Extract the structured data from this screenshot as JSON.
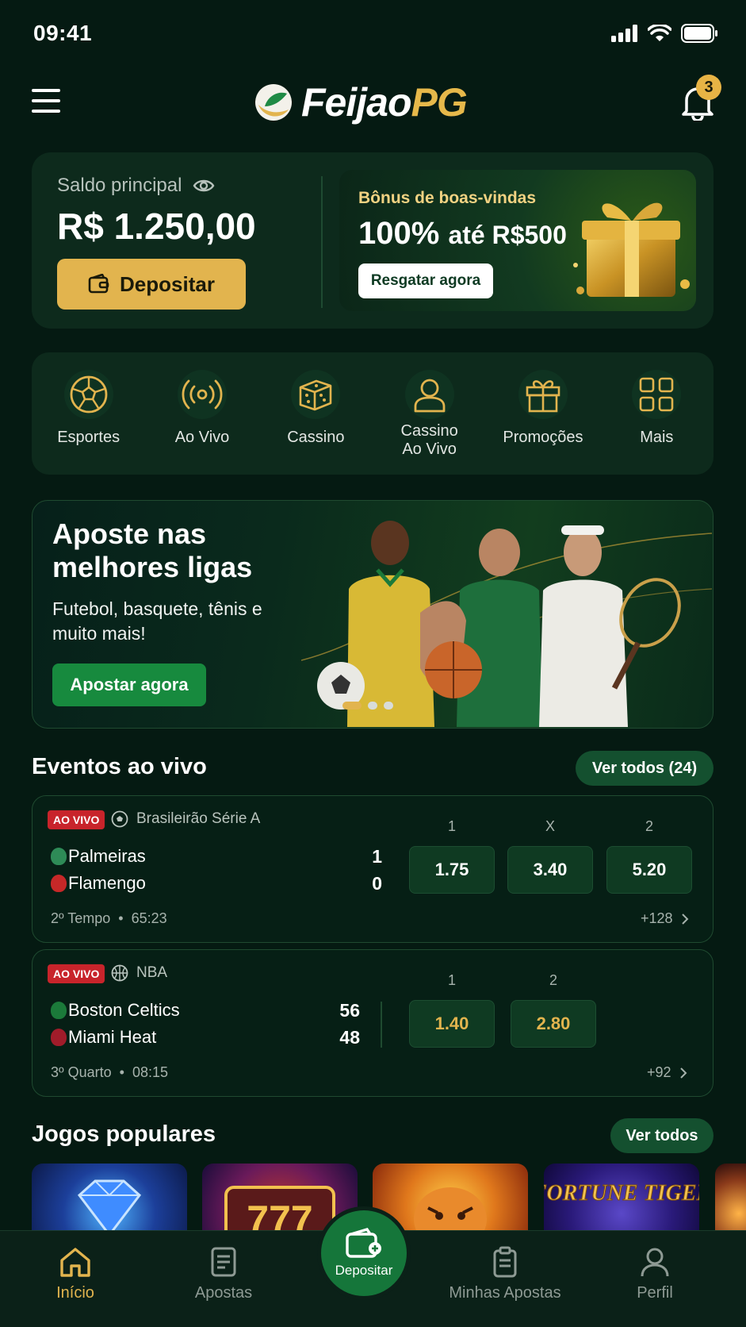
{
  "status_bar": {
    "time": "09:41"
  },
  "header": {
    "brand_main": "Feijao",
    "brand_accent": "PG",
    "notification_count": "3"
  },
  "balance": {
    "label": "Saldo principal",
    "value": "R$ 1.250,00",
    "deposit_label": "Depositar"
  },
  "bonus": {
    "subtitle": "Bônus de boas-vindas",
    "title_main": "100%",
    "title_rest": "até R$500",
    "button_label": "Resgatar agora"
  },
  "quick_nav": [
    {
      "label": "Esportes",
      "icon": "soccer-ball-icon"
    },
    {
      "label": "Ao Vivo",
      "icon": "live-broadcast-icon"
    },
    {
      "label": "Cassino",
      "icon": "dice-icon"
    },
    {
      "label": "Cassino Ao Vivo",
      "icon": "dealer-icon"
    },
    {
      "label": "Promoções",
      "icon": "gift-icon"
    },
    {
      "label": "Mais",
      "icon": "grid-icon"
    }
  ],
  "hero": {
    "title": "Aposte nas melhores ligas",
    "subtitle": "Futebol, basquete, tênis e muito mais!",
    "button_label": "Apostar agora",
    "slide_count": 3,
    "active_slide": 1
  },
  "live_section": {
    "title": "Eventos ao vivo",
    "view_all": "Ver todos (24)"
  },
  "events": [
    {
      "live_label": "AO VIVO",
      "league": "Brasileirão Série A",
      "teams": [
        {
          "name": "Palmeiras",
          "score": "1",
          "color": "#2e8b57"
        },
        {
          "name": "Flamengo",
          "score": "0",
          "color": "#c62828"
        }
      ],
      "odds_headers": [
        "1",
        "X",
        "2"
      ],
      "odds": [
        "1.75",
        "3.40",
        "5.20"
      ],
      "period": "2º Tempo",
      "clock": "65:23",
      "more_markets": "+128"
    },
    {
      "live_label": "AO VIVO",
      "league": "NBA",
      "teams": [
        {
          "name": "Boston Celtics",
          "score": "56",
          "color": "#1b7a3a"
        },
        {
          "name": "Miami Heat",
          "score": "48",
          "color": "#a01c2a"
        }
      ],
      "odds_headers": [
        "1",
        "2"
      ],
      "odds": [
        "1.40",
        "2.80"
      ],
      "period": "3º Quarto",
      "clock": "08:15",
      "more_markets": "+92"
    }
  ],
  "popular": {
    "title": "Jogos populares",
    "view_all": "Ver todos",
    "tile_text": "FORTUNE TIGER"
  },
  "bottom_nav": {
    "home": "Início",
    "bets": "Apostas",
    "deposit": "Depositar",
    "my_bets": "Minhas Apostas",
    "profile": "Perfil"
  },
  "colors": {
    "accent": "#e2b44e",
    "primary": "#15763a",
    "live": "#c8242b",
    "background": "#051a12"
  }
}
